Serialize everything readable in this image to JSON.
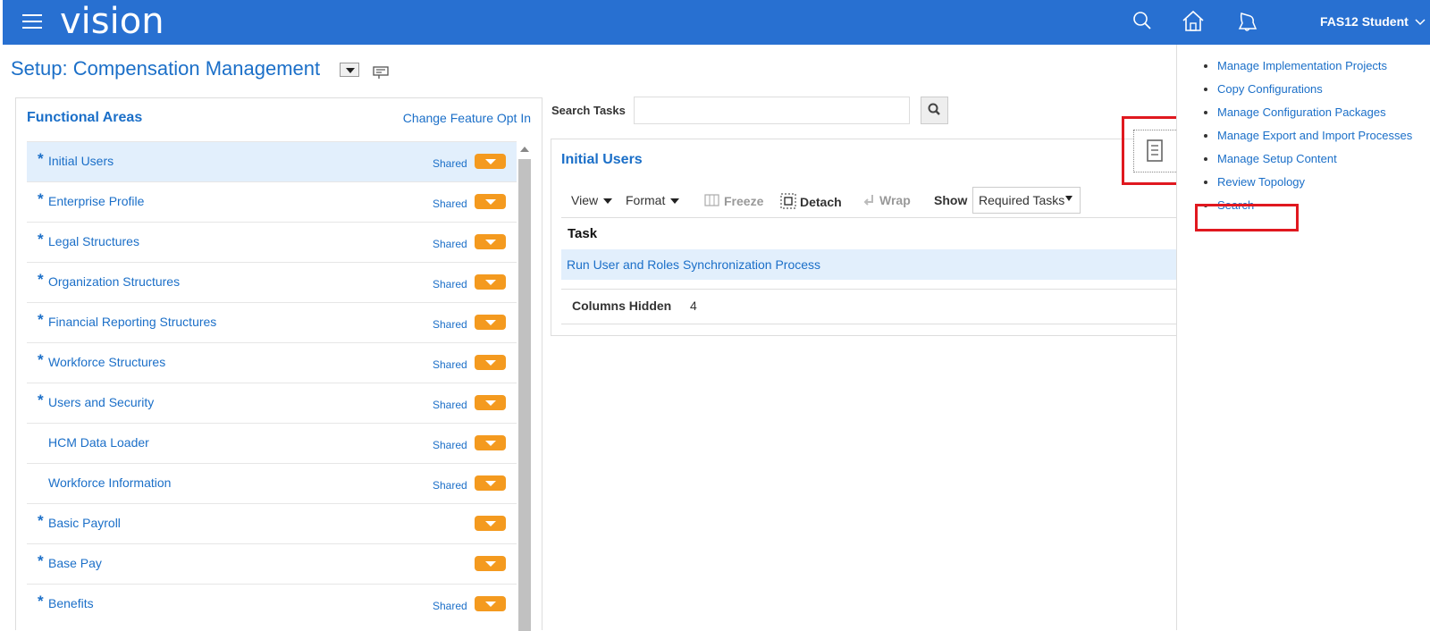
{
  "header": {
    "brand": "vision",
    "user": "FAS12 Student",
    "icons": [
      "menu-icon",
      "search-icon",
      "home-icon",
      "notifications-icon",
      "chevron-down-icon"
    ]
  },
  "page": {
    "title": "Setup: Compensation Management"
  },
  "functional_areas": {
    "heading": "Functional Areas",
    "link": "Change Feature Opt In",
    "items": [
      {
        "label": "Initial Users",
        "required": "*",
        "shared": "Shared"
      },
      {
        "label": "Enterprise Profile",
        "required": "*",
        "shared": "Shared"
      },
      {
        "label": "Legal Structures",
        "required": "*",
        "shared": "Shared"
      },
      {
        "label": "Organization Structures",
        "required": "*",
        "shared": "Shared"
      },
      {
        "label": "Financial Reporting Structures",
        "required": "*",
        "shared": "Shared"
      },
      {
        "label": "Workforce Structures",
        "required": "*",
        "shared": "Shared"
      },
      {
        "label": "Users and Security",
        "required": "*",
        "shared": "Shared"
      },
      {
        "label": "HCM Data Loader",
        "required": "",
        "shared": "Shared"
      },
      {
        "label": "Workforce Information",
        "required": "",
        "shared": "Shared"
      },
      {
        "label": "Basic Payroll",
        "required": "*",
        "shared": ""
      },
      {
        "label": "Base Pay",
        "required": "*",
        "shared": ""
      },
      {
        "label": "Benefits",
        "required": "*",
        "shared": "Shared"
      }
    ]
  },
  "search": {
    "label": "Search Tasks",
    "value": "",
    "placeholder": ""
  },
  "initial_users": {
    "title": "Initial Users",
    "toolbar": {
      "view": "View",
      "format": "Format",
      "freeze": "Freeze",
      "detach": "Detach",
      "wrap": "Wrap",
      "show_label": "Show",
      "show_value": "Required Tasks"
    },
    "column_task": "Task",
    "rows": [
      "Run User and Roles Synchronization Process"
    ],
    "columns_hidden_label": "Columns Hidden",
    "columns_hidden_value": "4"
  },
  "right_panel": {
    "items": [
      "Manage Implementation Projects",
      "Copy Configurations",
      "Manage Configuration Packages",
      "Manage Export and Import Processes",
      "Manage Setup Content",
      "Review Topology",
      "Search"
    ]
  },
  "colors": {
    "header_bg": "#2870d1",
    "link": "#1b6fc8",
    "accent_orange": "#f49a1f",
    "selection_bg": "#e2effc",
    "highlight_red": "#e0181f"
  }
}
